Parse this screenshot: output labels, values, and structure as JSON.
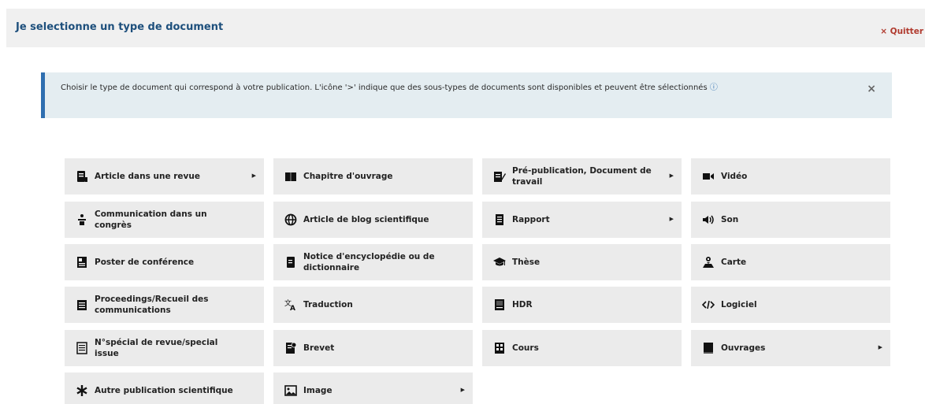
{
  "header": {
    "title": "Je selectionne un type de document",
    "quit_label": "× Quitter"
  },
  "info": {
    "text": "Choisir le type de document qui correspond à votre publication. L'icône '>' indique que des sous-types de documents sont disponibles et peuvent être sélectionnés",
    "help_icon": "ⓘ",
    "close_label": "×"
  },
  "documents": [
    {
      "label": "Article dans une revue",
      "icon": "journal-article-icon",
      "has_subtypes": true
    },
    {
      "label": "Chapitre d'ouvrage",
      "icon": "open-book-icon",
      "has_subtypes": false
    },
    {
      "label": "Pré-publication, Document de travail",
      "icon": "preprint-icon",
      "has_subtypes": true
    },
    {
      "label": "Vidéo",
      "icon": "video-icon",
      "has_subtypes": false
    },
    {
      "label": "Communication dans un congrès",
      "icon": "speaker-podium-icon",
      "has_subtypes": false
    },
    {
      "label": "Article de blog scientifique",
      "icon": "globe-icon",
      "has_subtypes": false
    },
    {
      "label": "Rapport",
      "icon": "report-icon",
      "has_subtypes": true
    },
    {
      "label": "Son",
      "icon": "sound-icon",
      "has_subtypes": false
    },
    {
      "label": "Poster de conférence",
      "icon": "poster-icon",
      "has_subtypes": false
    },
    {
      "label": "Notice d'encyclopédie ou de dictionnaire",
      "icon": "dictionary-icon",
      "has_subtypes": false
    },
    {
      "label": "Thèse",
      "icon": "graduation-cap-icon",
      "has_subtypes": false
    },
    {
      "label": "Carte",
      "icon": "map-icon",
      "has_subtypes": false
    },
    {
      "label": "Proceedings/Recueil des communications",
      "icon": "proceedings-icon",
      "has_subtypes": false
    },
    {
      "label": "Traduction",
      "icon": "translate-icon",
      "has_subtypes": false
    },
    {
      "label": "HDR",
      "icon": "hdr-icon",
      "has_subtypes": false
    },
    {
      "label": "Logiciel",
      "icon": "code-icon",
      "has_subtypes": false
    },
    {
      "label": "N°spécial de revue/special issue",
      "icon": "special-issue-icon",
      "has_subtypes": false
    },
    {
      "label": "Brevet",
      "icon": "patent-icon",
      "has_subtypes": false
    },
    {
      "label": "Cours",
      "icon": "course-icon",
      "has_subtypes": false
    },
    {
      "label": "Ouvrages",
      "icon": "book-icon",
      "has_subtypes": true
    },
    {
      "label": "Autre publication scientifique",
      "icon": "asterisk-icon",
      "has_subtypes": false
    },
    {
      "label": "Image",
      "icon": "image-icon",
      "has_subtypes": true
    }
  ],
  "chevron_glyph": "▶"
}
